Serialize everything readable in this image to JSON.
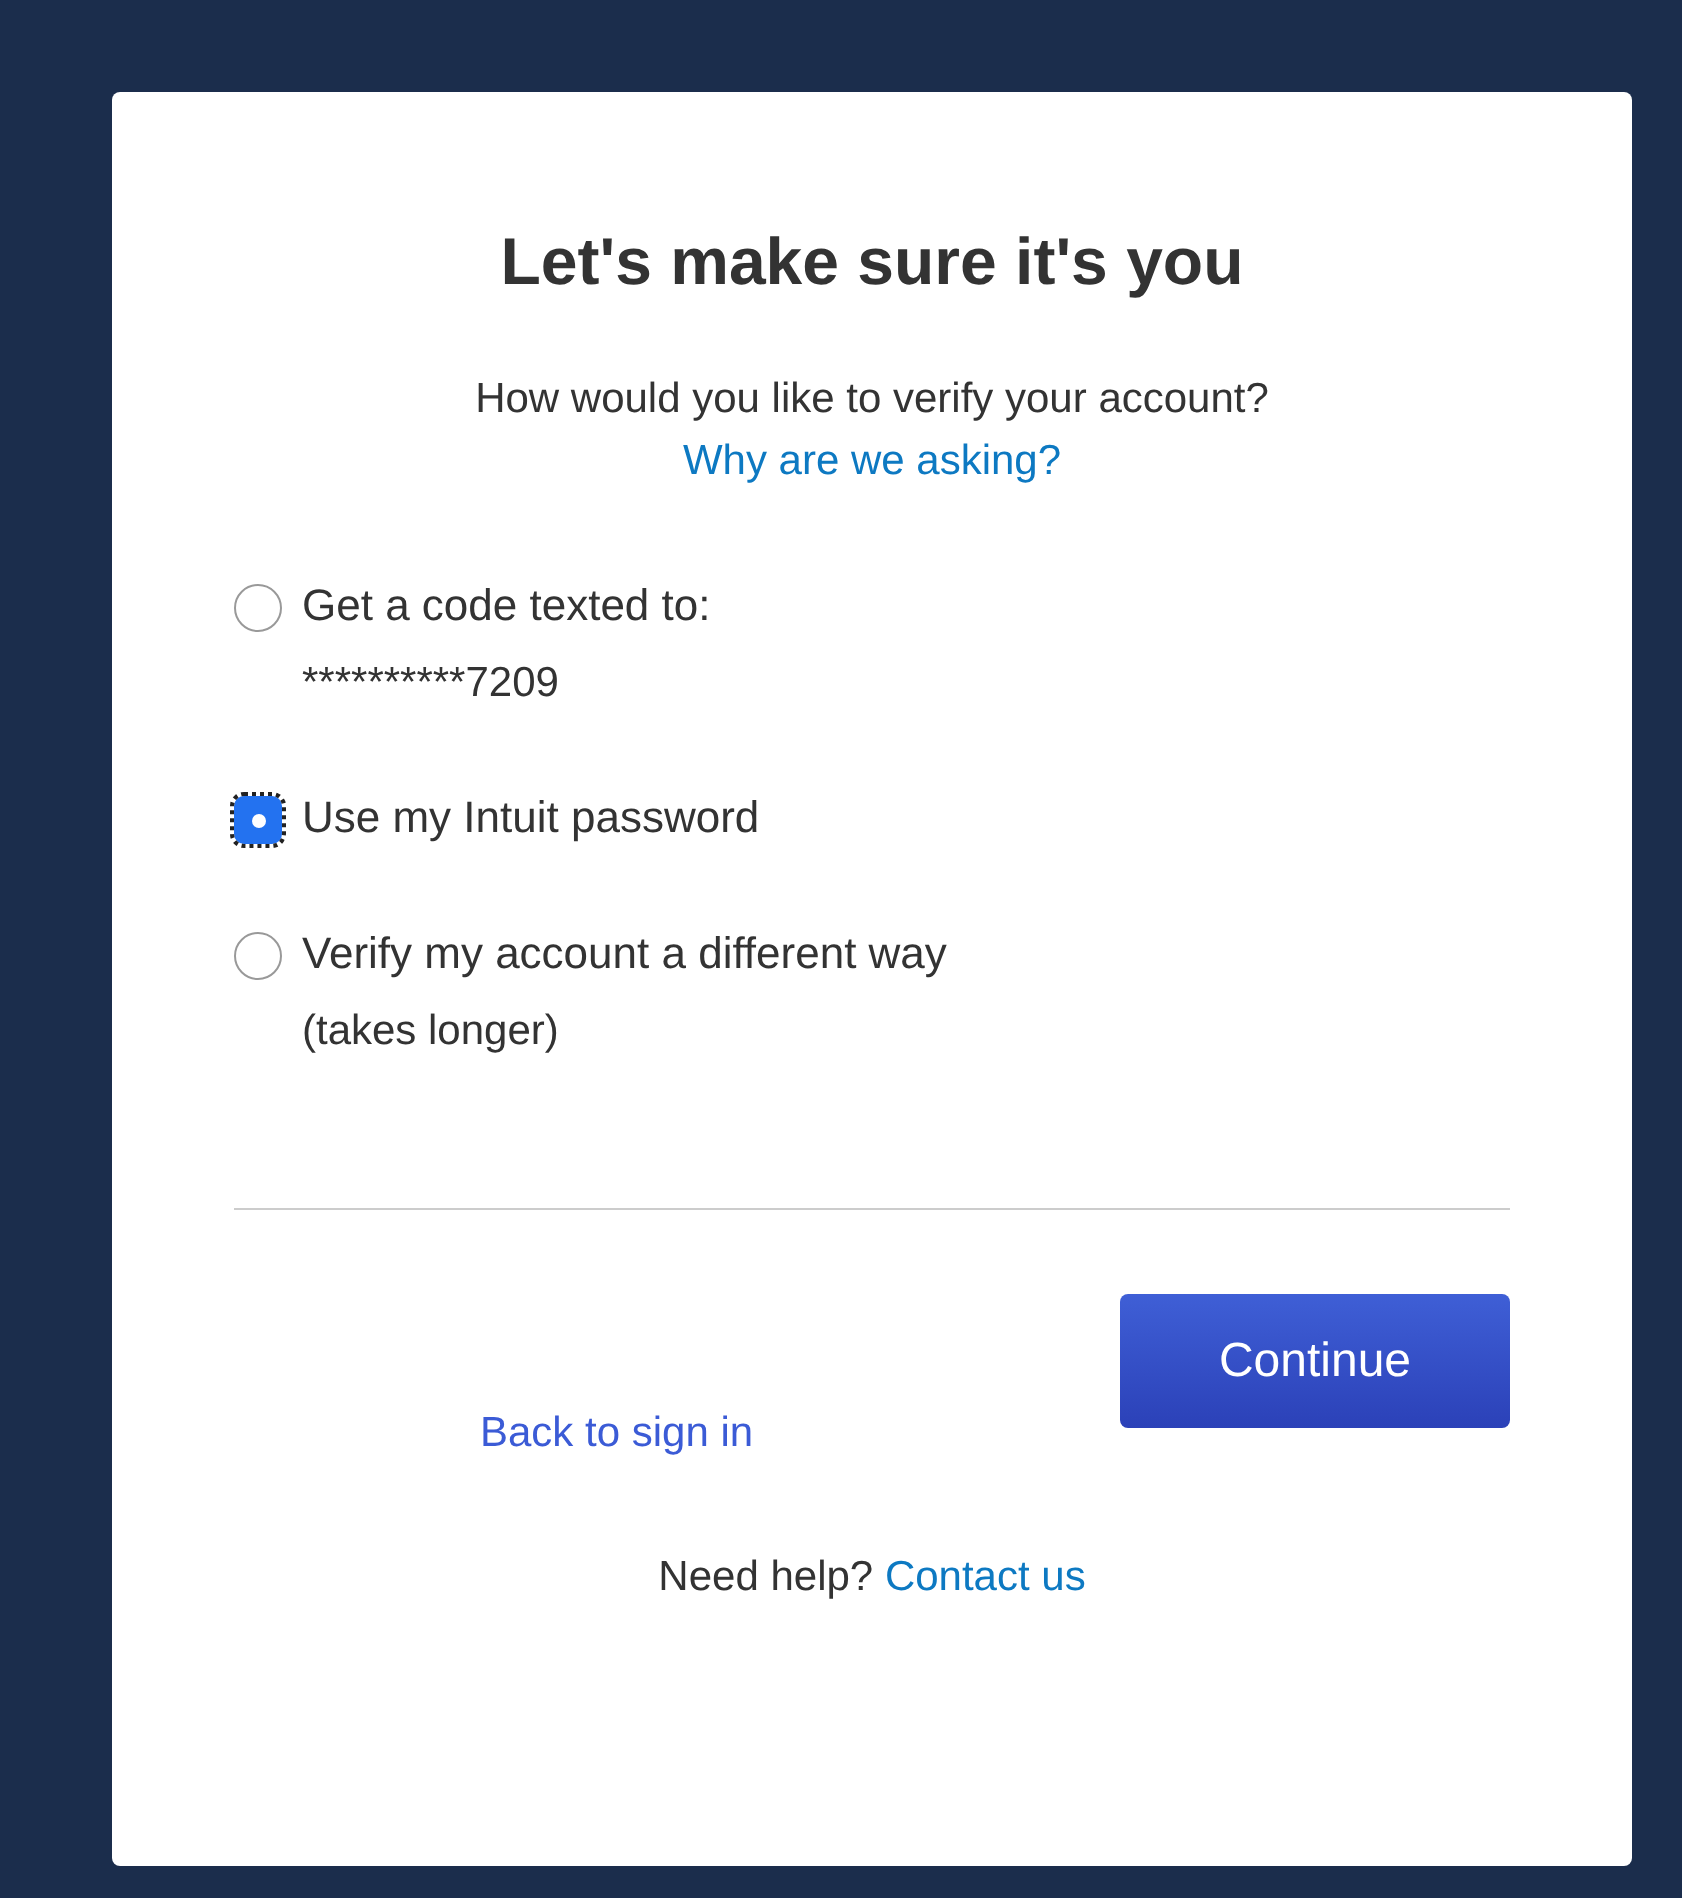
{
  "title": "Let's make sure it's you",
  "question": "How would you like to verify your account?",
  "why_link": "Why are we asking?",
  "options": [
    {
      "label": "Get a code texted to:",
      "detail": "**********7209",
      "selected": false
    },
    {
      "label": "Use my Intuit password",
      "selected": true
    },
    {
      "label": "Verify my account a different way",
      "detail": "(takes longer)",
      "selected": false
    }
  ],
  "continue_button": "Continue",
  "back_link": "Back to sign in",
  "help": {
    "text": "Need help?",
    "link": "Contact us"
  }
}
